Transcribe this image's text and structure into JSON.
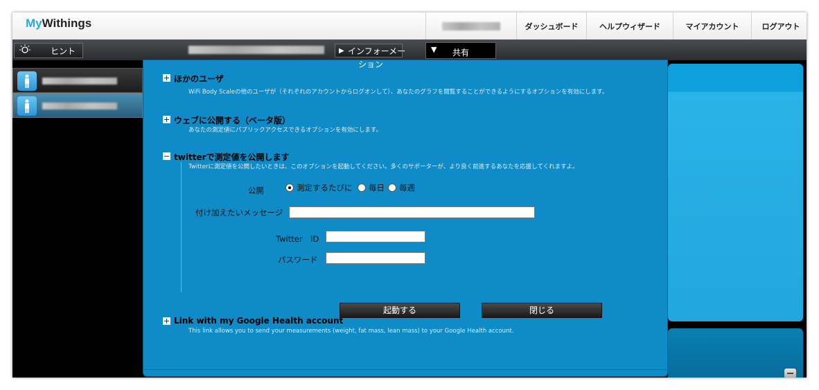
{
  "app": {
    "logo_my": "My",
    "logo_withings": "Withings"
  },
  "topnav": {
    "username_blurred": "",
    "items": [
      "ダッシュボード",
      "ヘルプウィザード",
      "マイアカウント",
      "ログアウト"
    ]
  },
  "toolbar": {
    "hint_label": "ヒント",
    "info_label_line1": "インフォーメー",
    "info_label_line2": "ション",
    "share_label": "共有"
  },
  "modal": {
    "sections": {
      "other_users": {
        "title": "ほかのユーザ",
        "desc": "WiFi Body Scaleの他のユーザが（それぞれのアカウントからログオンして）、あなたのグラフを閲覧することができるようにするオプションを有効にします。"
      },
      "web_publish": {
        "title": "ウェブに公開する（ベータ版）",
        "desc": "あなたの測定値にパブリックアクセスできるオプションを有効にします。"
      },
      "twitter": {
        "title": "twitterで測定値を公開します",
        "desc": "Twitterに測定値を公開したいときは、このオプションを起動してください。多くのサポーターが、より良く前進するあなたを応援してくれますよ。"
      },
      "google": {
        "title": "Link with my Google Health account",
        "desc": "This link allows you to send your measurements (weight, fat mass, lean mass) to your Google Health account."
      }
    },
    "twitter_form": {
      "publish_label": "公開",
      "radio_options": [
        "測定するたびに",
        "毎日",
        "毎週"
      ],
      "selected_radio": "測定するたびに",
      "message_label": "付け加えたいメッセージ",
      "message_value": "",
      "id_label": "Twitter　ID",
      "id_value": "",
      "password_label": "パスワード",
      "password_value": ""
    },
    "buttons": {
      "activate": "起動する",
      "close": "閉じる"
    }
  }
}
